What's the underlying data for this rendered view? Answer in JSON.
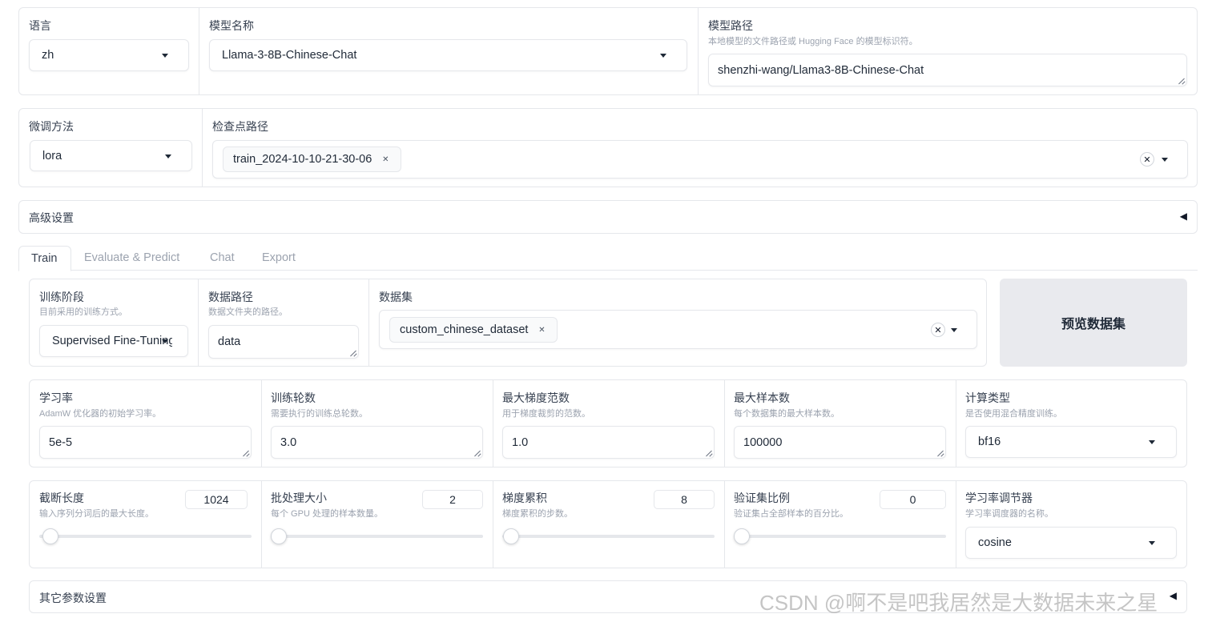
{
  "top_row": {
    "language": {
      "label": "语言",
      "value": "zh"
    },
    "model_name": {
      "label": "模型名称",
      "value": "Llama-3-8B-Chinese-Chat"
    },
    "model_path": {
      "label": "模型路径",
      "description": "本地模型的文件路径或 Hugging Face 的模型标识符。",
      "value": "shenzhi-wang/Llama3-8B-Chinese-Chat"
    }
  },
  "second_row": {
    "finetune_method": {
      "label": "微调方法",
      "value": "lora"
    },
    "checkpoint_path": {
      "label": "检查点路径",
      "chips": [
        "train_2024-10-10-21-30-06"
      ]
    }
  },
  "advanced": {
    "label": "高级设置",
    "toggle_icon": "◀"
  },
  "tabs": [
    {
      "label": "Train",
      "active": true
    },
    {
      "label": "Evaluate & Predict",
      "active": false
    },
    {
      "label": "Chat",
      "active": false
    },
    {
      "label": "Export",
      "active": false
    }
  ],
  "train": {
    "stage": {
      "label": "训练阶段",
      "description": "目前采用的训练方式。",
      "value": "Supervised Fine-Tuning"
    },
    "data_dir": {
      "label": "数据路径",
      "description": "数据文件夹的路径。",
      "value": "data"
    },
    "dataset": {
      "label": "数据集",
      "chips": [
        "custom_chinese_dataset"
      ]
    },
    "preview_button": "预览数据集",
    "learning_rate": {
      "label": "学习率",
      "description": "AdamW 优化器的初始学习率。",
      "value": "5e-5"
    },
    "epochs": {
      "label": "训练轮数",
      "description": "需要执行的训练总轮数。",
      "value": "3.0"
    },
    "max_grad_norm": {
      "label": "最大梯度范数",
      "description": "用于梯度裁剪的范数。",
      "value": "1.0"
    },
    "max_samples": {
      "label": "最大样本数",
      "description": "每个数据集的最大样本数。",
      "value": "100000"
    },
    "compute_type": {
      "label": "计算类型",
      "description": "是否使用混合精度训练。",
      "value": "bf16"
    },
    "cutoff_len": {
      "label": "截断长度",
      "description": "输入序列分词后的最大长度。",
      "value": "1024",
      "fraction": 0.0
    },
    "batch_size": {
      "label": "批处理大小",
      "description": "每个 GPU 处理的样本数量。",
      "value": "2",
      "fraction": 0.0
    },
    "grad_accum": {
      "label": "梯度累积",
      "description": "梯度累积的步数。",
      "value": "8",
      "fraction": 0.0
    },
    "val_size": {
      "label": "验证集比例",
      "description": "验证集占全部样本的百分比。",
      "value": "0",
      "fraction": 0.0
    },
    "lr_scheduler": {
      "label": "学习率调节器",
      "description": "学习率调度器的名称。",
      "value": "cosine"
    },
    "other_settings": {
      "label": "其它参数设置"
    }
  },
  "watermark": "CSDN @啊不是吧我居然是大数据未来之星"
}
